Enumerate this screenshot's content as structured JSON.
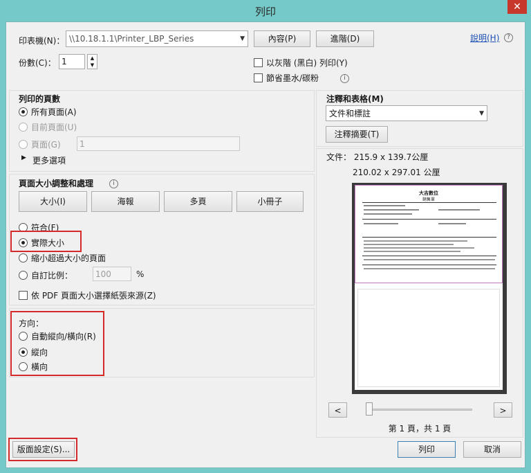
{
  "window": {
    "title": "列印",
    "close": "✕"
  },
  "printer": {
    "label": "印表機(N)：",
    "value": "\\\\10.18.1.1\\Printer_LBP_Series",
    "properties_btn": "內容(P)",
    "advanced_btn": "進階(D)",
    "help_link": "說明(H)"
  },
  "copies": {
    "label": "份數(C)：",
    "value": "1"
  },
  "options": {
    "grayscale": "以灰階 (黑白) 列印(Y)",
    "save_ink": "節省墨水/碳粉"
  },
  "pages": {
    "title": "列印的頁數",
    "all": "所有頁面(A)",
    "current": "目前頁面(U)",
    "pages": "頁面(G)",
    "pages_value": "1",
    "more": "更多選項"
  },
  "sizing": {
    "title": "頁面大小調整和處理",
    "tabs": [
      "大小(I)",
      "海報",
      "多頁",
      "小冊子"
    ],
    "fit": "符合(F)",
    "actual": "實際大小",
    "shrink": "縮小超過大小的頁面",
    "custom": "自訂比例：",
    "custom_value": "100",
    "percent": "%",
    "pdf_source": "依 PDF 頁面大小選擇紙張來源(Z)"
  },
  "orientation": {
    "title": "方向：",
    "auto": "自動縱向/橫向(R)",
    "portrait": "縱向",
    "landscape": "橫向"
  },
  "comments": {
    "title": "注釋和表格(M)",
    "value": "文件和標註",
    "summary_btn": "注釋摘要(T)"
  },
  "preview": {
    "doc_size": "文件： 215.9 x 139.7公厘",
    "paper_size": "210.02 x 297.01 公厘",
    "doc_title": "大吉數位",
    "doc_subtitle": "銷售單",
    "prev": "<",
    "next": ">",
    "page_info": "第 1 頁，共 1 頁"
  },
  "footer": {
    "page_setup": "版面設定(S)...",
    "print": "列印",
    "cancel": "取消"
  }
}
